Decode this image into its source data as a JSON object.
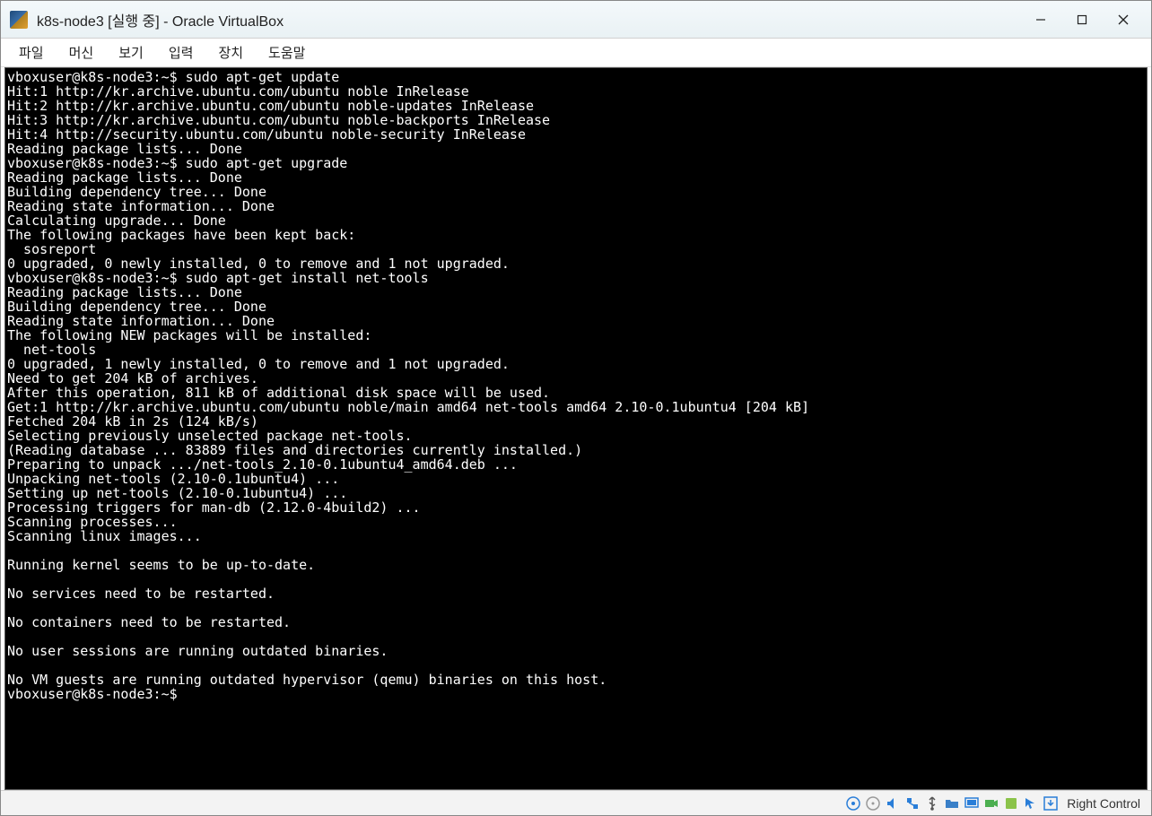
{
  "window": {
    "title": "k8s-node3 [실행 중] - Oracle VirtualBox"
  },
  "menubar": {
    "items": [
      "파일",
      "머신",
      "보기",
      "입력",
      "장치",
      "도움말"
    ]
  },
  "terminal": {
    "lines": [
      "vboxuser@k8s-node3:~$ sudo apt-get update",
      "Hit:1 http://kr.archive.ubuntu.com/ubuntu noble InRelease",
      "Hit:2 http://kr.archive.ubuntu.com/ubuntu noble-updates InRelease",
      "Hit:3 http://kr.archive.ubuntu.com/ubuntu noble-backports InRelease",
      "Hit:4 http://security.ubuntu.com/ubuntu noble-security InRelease",
      "Reading package lists... Done",
      "vboxuser@k8s-node3:~$ sudo apt-get upgrade",
      "Reading package lists... Done",
      "Building dependency tree... Done",
      "Reading state information... Done",
      "Calculating upgrade... Done",
      "The following packages have been kept back:",
      "  sosreport",
      "0 upgraded, 0 newly installed, 0 to remove and 1 not upgraded.",
      "vboxuser@k8s-node3:~$ sudo apt-get install net-tools",
      "Reading package lists... Done",
      "Building dependency tree... Done",
      "Reading state information... Done",
      "The following NEW packages will be installed:",
      "  net-tools",
      "0 upgraded, 1 newly installed, 0 to remove and 1 not upgraded.",
      "Need to get 204 kB of archives.",
      "After this operation, 811 kB of additional disk space will be used.",
      "Get:1 http://kr.archive.ubuntu.com/ubuntu noble/main amd64 net-tools amd64 2.10-0.1ubuntu4 [204 kB]",
      "Fetched 204 kB in 2s (124 kB/s)",
      "Selecting previously unselected package net-tools.",
      "(Reading database ... 83889 files and directories currently installed.)",
      "Preparing to unpack .../net-tools_2.10-0.1ubuntu4_amd64.deb ...",
      "Unpacking net-tools (2.10-0.1ubuntu4) ...",
      "Setting up net-tools (2.10-0.1ubuntu4) ...",
      "Processing triggers for man-db (2.12.0-4build2) ...",
      "Scanning processes...",
      "Scanning linux images...",
      "",
      "Running kernel seems to be up-to-date.",
      "",
      "No services need to be restarted.",
      "",
      "No containers need to be restarted.",
      "",
      "No user sessions are running outdated binaries.",
      "",
      "No VM guests are running outdated hypervisor (qemu) binaries on this host.",
      "vboxuser@k8s-node3:~$"
    ]
  },
  "statusbar": {
    "hostkey": "Right Control"
  }
}
